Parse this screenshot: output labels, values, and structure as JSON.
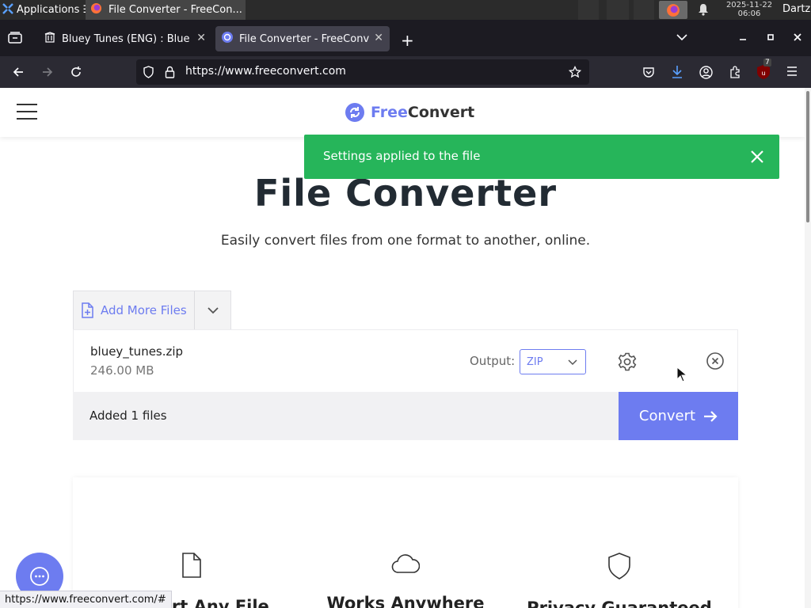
{
  "taskbar": {
    "apps_label": "Applications ☰",
    "window_title": "File Converter - FreeCon...",
    "clock_date": "2025-11-22",
    "clock_time": "06:06",
    "user": "Dartz"
  },
  "browser": {
    "tabs": [
      {
        "title": "Bluey Tunes (ENG) : Blue",
        "active": false
      },
      {
        "title": "File Converter - FreeConv",
        "active": true
      }
    ],
    "url": "https://www.freeconvert.com",
    "extension_badge": "7",
    "status_url": "https://www.freeconvert.com/#"
  },
  "site": {
    "logo_free": "Free",
    "logo_convert": "Convert",
    "brand_color": "#6d7cf0",
    "toast_color": "#26b55a"
  },
  "toast": {
    "message": "Settings applied to the file"
  },
  "hero": {
    "title": "File Converter",
    "subtitle": "Easily convert files from one format to another, online."
  },
  "uploader": {
    "add_more_label": "Add More Files",
    "file": {
      "name": "bluey_tunes.zip",
      "size": "246.00 MB"
    },
    "output_label": "Output:",
    "output_value": "ZIP",
    "added_text": "Added 1 files",
    "convert_label": "Convert"
  },
  "features": [
    {
      "title": "Convert Any File",
      "icon": "file-icon"
    },
    {
      "title": "Works Anywhere",
      "icon": "cloud-icon"
    },
    {
      "title": "Privacy Guaranteed",
      "icon": "shield-icon"
    }
  ]
}
